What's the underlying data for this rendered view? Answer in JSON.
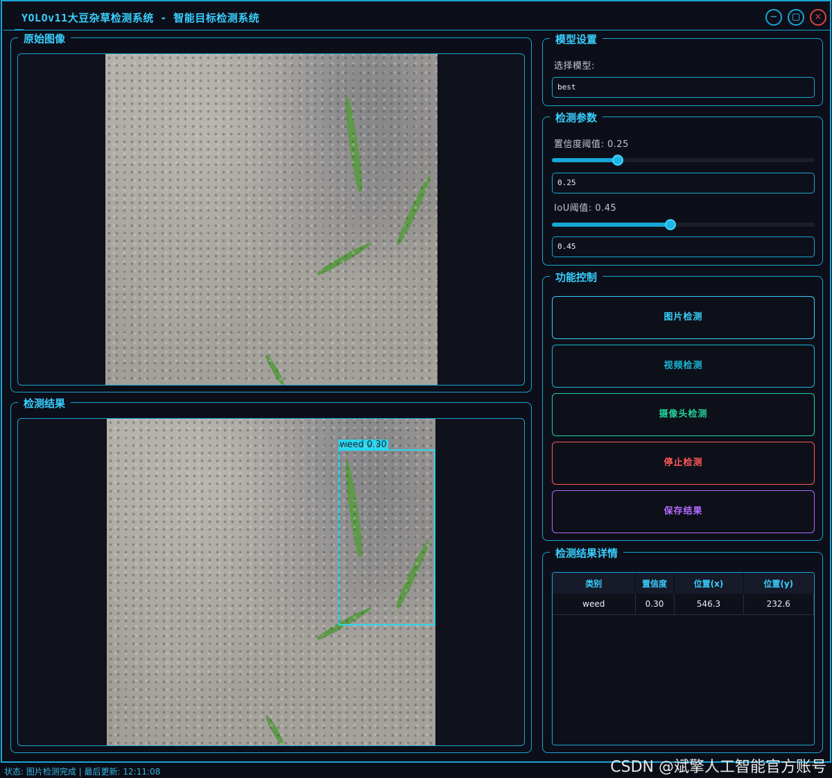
{
  "window": {
    "title": "YOLOv11大豆杂草检测系统 - 智能目标检测系统",
    "minimize_glyph": "−",
    "maximize_glyph": "▢",
    "close_glyph": "×"
  },
  "original_panel": {
    "title": "原始图像"
  },
  "result_panel": {
    "title": "检测结果",
    "detections_overlay": [
      {
        "label": "weed 0.30",
        "class": "weed",
        "confidence": 0.3
      }
    ]
  },
  "model_settings": {
    "title": "模型设置",
    "select_label": "选择模型:",
    "model_value": "best"
  },
  "detect_params": {
    "title": "检测参数",
    "confidence_label": "置信度阈值: 0.25",
    "confidence_value": "0.25",
    "confidence_level": 0.25,
    "iou_label": "IoU阈值: 0.45",
    "iou_value": "0.45",
    "iou_level": 0.45
  },
  "function_control": {
    "title": "功能控制",
    "buttons": [
      {
        "label": "图片检测",
        "color": "#38d0ff"
      },
      {
        "label": "视频检测",
        "color": "#1ab8d8"
      },
      {
        "label": "摄像头检测",
        "color": "#22d39a"
      },
      {
        "label": "停止检测",
        "color": "#ff5a5a"
      },
      {
        "label": "保存结果",
        "color": "#b36bff"
      }
    ]
  },
  "results_detail": {
    "title": "检测结果详情",
    "columns": [
      "类别",
      "置信度",
      "位置(x)",
      "位置(y)"
    ],
    "rows": [
      [
        "weed",
        "0.30",
        "546.3",
        "232.6"
      ]
    ]
  },
  "statusbar": {
    "text": "状态: 图片检测完成 | 最后更新: 12:11:08"
  },
  "watermark": {
    "text": "CSDN @斌擎人工智能官方账号"
  },
  "colors": {
    "accent": "#1aa6d6",
    "accent_text": "#38d0ff",
    "detection_box": "#2ad7f0",
    "background": "#0c0f19"
  },
  "icons": [
    "minimize-icon",
    "maximize-icon",
    "close-icon"
  ]
}
